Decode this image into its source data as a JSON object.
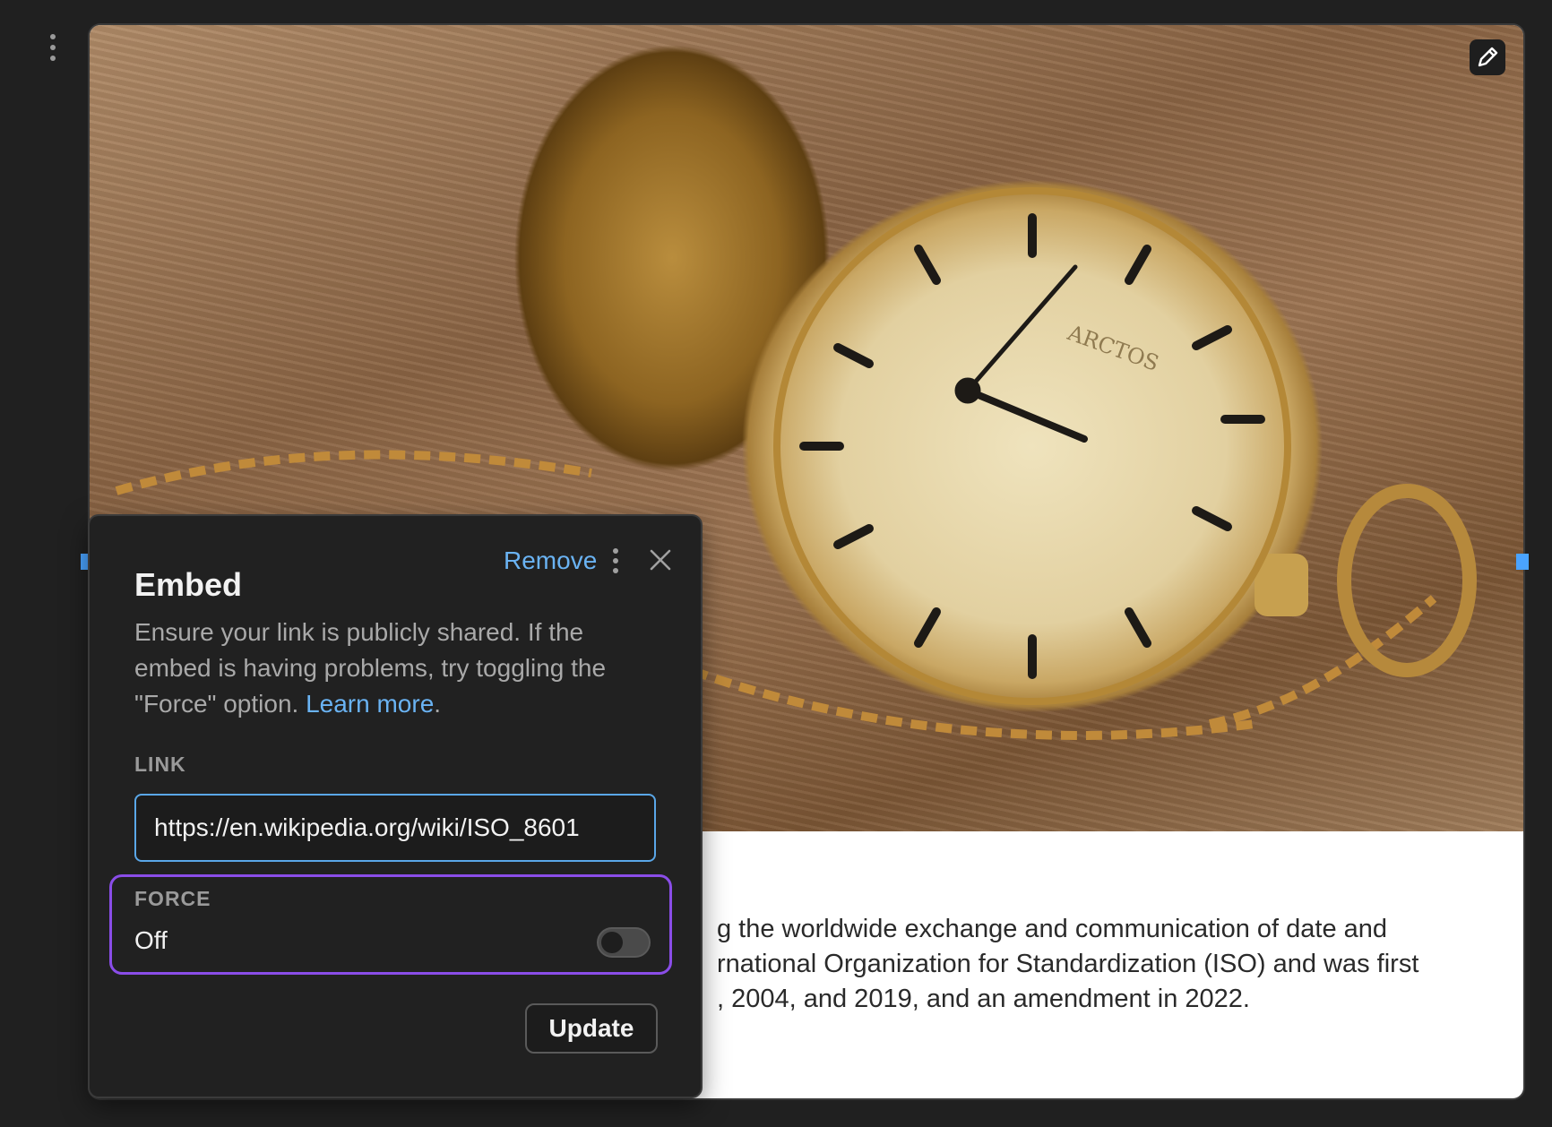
{
  "embed": {
    "body_lines": [
      "g the worldwide exchange and communication of date and",
      "rnational Organization for Standardization (ISO) and was first",
      ", 2004, and 2019, and an amendment in 2022."
    ],
    "clock_brand": "ARCTOS"
  },
  "popover": {
    "title": "Embed",
    "remove_label": "Remove",
    "description": "Ensure your link is publicly shared. If the embed is having problems, try toggling the \"Force\" option.",
    "learn_more_label": "Learn more",
    "learn_more_suffix": ".",
    "link_label": "LINK",
    "link_value": "https://en.wikipedia.org/wiki/ISO_8601",
    "force_label": "FORCE",
    "force_value": "Off",
    "force_enabled": false,
    "update_label": "Update"
  },
  "icons": {
    "drag": "drag-handle-icon",
    "edit": "pencil-icon",
    "more": "more-vertical-icon",
    "close": "close-icon"
  },
  "colors": {
    "accent_link": "#6ab3f3",
    "input_focus_border": "#5aa7e8",
    "force_highlight": "#8a4de8",
    "resize_handle": "#4aa3ff"
  }
}
